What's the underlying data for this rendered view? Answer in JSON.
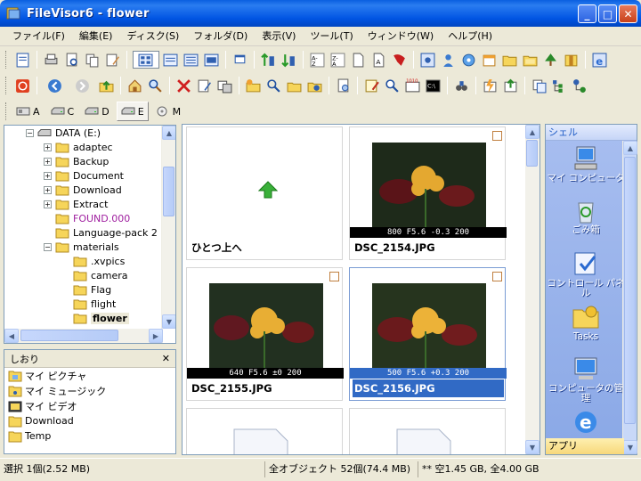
{
  "window": {
    "title": "FileVisor6 - flower",
    "min": "_",
    "max": "□",
    "close": "✕"
  },
  "menu": [
    "ファイル(F)",
    "編集(E)",
    "ディスク(S)",
    "フォルダ(D)",
    "表示(V)",
    "ツール(T)",
    "ウィンドウ(W)",
    "ヘルプ(H)"
  ],
  "drives": [
    "A",
    "C",
    "D",
    "E",
    "M"
  ],
  "selected_drive": "E",
  "tree": {
    "root": "DATA (E:)",
    "items": [
      "adaptec",
      "Backup",
      "Document",
      "Download",
      "Extract",
      "FOUND.000",
      "Language-pack 2",
      "materials"
    ],
    "subitems": [
      ".xvpics",
      "camera",
      "Flag",
      "flight",
      "flower"
    ],
    "selected": "flower"
  },
  "bookmarks": {
    "title": "しおり",
    "close": "✕",
    "items": [
      "マイ ピクチャ",
      "マイ ミュージック",
      "マイ ビデオ",
      "Download",
      "Temp"
    ]
  },
  "thumbs": [
    {
      "name": "ひとつ上へ",
      "caption": ""
    },
    {
      "name": "DSC_2154.JPG",
      "caption": "800 F5.6 -0.3 200"
    },
    {
      "name": "DSC_2155.JPG",
      "caption": "640 F5.6 ±0 200"
    },
    {
      "name": "DSC_2156.JPG",
      "caption": "500 F5.6 +0.3 200"
    }
  ],
  "shell": {
    "title": "シェル",
    "items": [
      "マイ コンピュータ",
      "ごみ箱",
      "コントロール パネル",
      "Tasks",
      "コンピュータの管理"
    ],
    "footer": "アプリ"
  },
  "status": {
    "selection": "選択 1個(2.52 MB)",
    "total": "全オブジェクト 52個(74.4 MB)",
    "disk": "** 空1.45 GB, 全4.00 GB"
  }
}
